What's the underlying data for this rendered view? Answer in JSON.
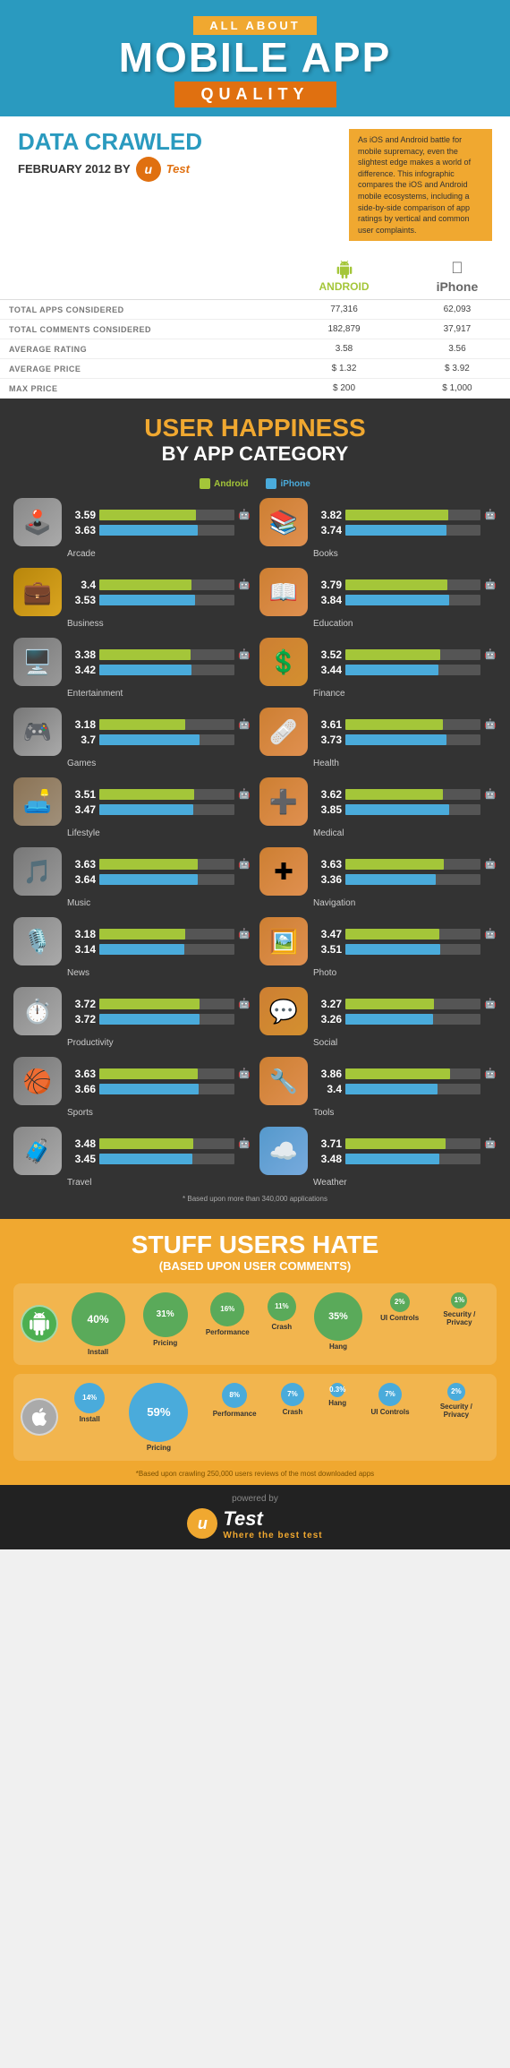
{
  "header": {
    "pre_title": "ALL ABOUT",
    "main_title": "MOBILE APP",
    "sub_title": "QUALITY"
  },
  "data_crawled": {
    "line1": "DATA CRAWLED",
    "line2": "FEBRUARY 2012 BY",
    "utest": "u",
    "note": "As iOS and Android battle for mobile supremacy, even the slightest edge makes a world of difference. This infographic compares the iOS and Android mobile ecosystems, including a side-by-side comparison of app ratings by vertical and common user complaints."
  },
  "stats": {
    "android_label": "ANDROID",
    "iphone_label": "iPhone",
    "rows": [
      {
        "label": "TOTAL APPS CONSIDERED",
        "android": "77,316",
        "iphone": "62,093"
      },
      {
        "label": "TOTAL COMMENTS CONSIDERED",
        "android": "182,879",
        "iphone": "37,917"
      },
      {
        "label": "AVERAGE RATING",
        "android": "3.58",
        "iphone": "3.56"
      },
      {
        "label": "AVERAGE PRICE",
        "android": "$ 1.32",
        "iphone": "$ 3.92"
      },
      {
        "label": "MAX PRICE",
        "android": "$ 200",
        "iphone": "$ 1,000"
      }
    ]
  },
  "user_happiness": {
    "title": "USER HAPPINESS",
    "subtitle": "BY APP CATEGORY",
    "categories": [
      {
        "name": "Arcade",
        "icon": "🕹️",
        "iconClass": "cat-icon-arcade",
        "android": 3.59,
        "apple": 3.63
      },
      {
        "name": "Books",
        "icon": "📚",
        "iconClass": "cat-icon-books",
        "android": 3.82,
        "apple": 3.74
      },
      {
        "name": "Business",
        "icon": "💼",
        "iconClass": "cat-icon-business",
        "android": 3.4,
        "apple": 3.53
      },
      {
        "name": "Education",
        "icon": "📖",
        "iconClass": "cat-icon-education",
        "android": 3.79,
        "apple": 3.84
      },
      {
        "name": "Entertainment",
        "icon": "🖥️",
        "iconClass": "cat-icon-entertainment",
        "android": 3.38,
        "apple": 3.42
      },
      {
        "name": "Finance",
        "icon": "💲",
        "iconClass": "cat-icon-finance",
        "android": 3.52,
        "apple": 3.44
      },
      {
        "name": "Games",
        "icon": "🎮",
        "iconClass": "cat-icon-games",
        "android": 3.18,
        "apple": 3.7
      },
      {
        "name": "Health",
        "icon": "🩹",
        "iconClass": "cat-icon-health",
        "android": 3.61,
        "apple": 3.73
      },
      {
        "name": "Lifestyle",
        "icon": "🛋️",
        "iconClass": "cat-icon-lifestyle",
        "android": 3.51,
        "apple": 3.47
      },
      {
        "name": "Medical",
        "icon": "➕",
        "iconClass": "cat-icon-medical",
        "android": 3.62,
        "apple": 3.85
      },
      {
        "name": "Music",
        "icon": "🎵",
        "iconClass": "cat-icon-music",
        "android": 3.63,
        "apple": 3.64
      },
      {
        "name": "Navigation",
        "icon": "✚",
        "iconClass": "cat-icon-navigation",
        "android": 3.63,
        "apple": 3.36
      },
      {
        "name": "News",
        "icon": "🎙️",
        "iconClass": "cat-icon-news",
        "android": 3.18,
        "apple": 3.14
      },
      {
        "name": "Photo",
        "icon": "🖼️",
        "iconClass": "cat-icon-photo",
        "android": 3.47,
        "apple": 3.51
      },
      {
        "name": "Productivity",
        "icon": "⏱️",
        "iconClass": "cat-icon-productivity",
        "android": 3.72,
        "apple": 3.72
      },
      {
        "name": "Social",
        "icon": "💬",
        "iconClass": "cat-icon-social",
        "android": 3.27,
        "apple": 3.26
      },
      {
        "name": "Sports",
        "icon": "🏀",
        "iconClass": "cat-icon-sports",
        "android": 3.63,
        "apple": 3.66
      },
      {
        "name": "Tools",
        "icon": "🔧",
        "iconClass": "cat-icon-tools",
        "android": 3.86,
        "apple": 3.4
      },
      {
        "name": "Travel",
        "icon": "🧳",
        "iconClass": "cat-icon-travel",
        "android": 3.48,
        "apple": 3.45
      },
      {
        "name": "Weather",
        "icon": "☁️",
        "iconClass": "cat-icon-weather",
        "android": 3.71,
        "apple": 3.48
      }
    ]
  },
  "stuff_hate": {
    "title": "STUFF USERS HATE",
    "subtitle": "(BASED UPON USER COMMENTS)",
    "note": "*Based upon crawling 250,000 users reviews of the most downloaded apps",
    "android": {
      "items": [
        {
          "label": "Install",
          "value": "40%",
          "size": 60,
          "color": "#5aaa5a"
        },
        {
          "label": "Pricing",
          "value": "31%",
          "size": 50,
          "color": "#5aaa5a"
        },
        {
          "label": "Performance",
          "value": "16%",
          "size": 38,
          "color": "#5aaa5a"
        },
        {
          "label": "Crash",
          "value": "11%",
          "size": 32,
          "color": "#5aaa5a"
        },
        {
          "label": "Hang",
          "value": "35%",
          "size": 54,
          "color": "#5aaa5a"
        },
        {
          "label": "UI Controls",
          "value": "2%",
          "size": 22,
          "color": "#5aaa5a"
        },
        {
          "label": "Security / Privacy",
          "value": "1%",
          "size": 18,
          "color": "#5aaa5a"
        }
      ]
    },
    "apple": {
      "items": [
        {
          "label": "Install",
          "value": "14%",
          "size": 34,
          "color": "#4aabdb"
        },
        {
          "label": "Pricing",
          "value": "59%",
          "size": 66,
          "color": "#4aabdb"
        },
        {
          "label": "Performance",
          "value": "8%",
          "size": 28,
          "color": "#4aabdb"
        },
        {
          "label": "Crash",
          "value": "7%",
          "size": 26,
          "color": "#4aabdb"
        },
        {
          "label": "Hang",
          "value": "0.3%",
          "size": 16,
          "color": "#4aabdb"
        },
        {
          "label": "UI Controls",
          "value": "7%",
          "size": 26,
          "color": "#4aabdb"
        },
        {
          "label": "Security / Privacy",
          "value": "2%",
          "size": 20,
          "color": "#4aabdb"
        }
      ]
    }
  },
  "footer": {
    "powered_by": "powered by",
    "utest_u": "u",
    "utest_text": "Test",
    "tagline": "Where the best test"
  }
}
